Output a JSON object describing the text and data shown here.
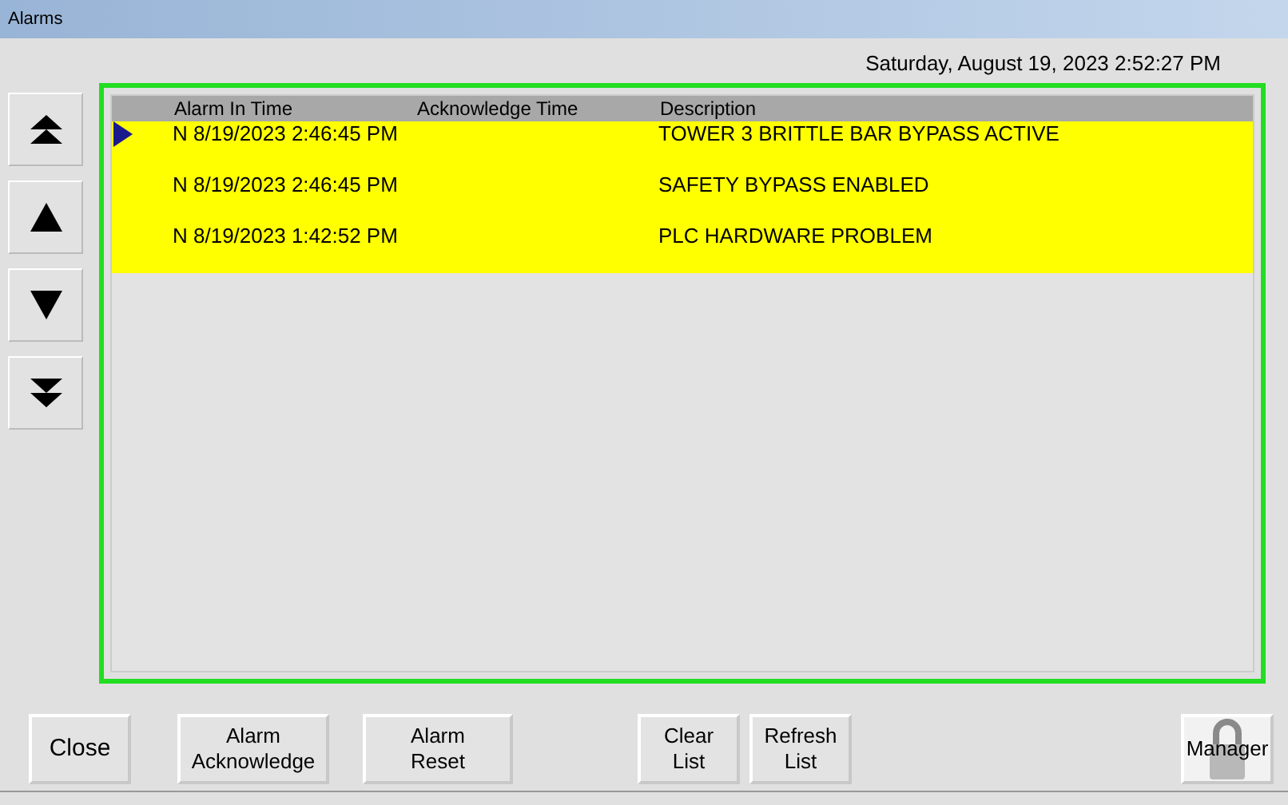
{
  "window": {
    "title": "Alarms"
  },
  "datetime": "Saturday, August 19, 2023 2:52:27 PM",
  "nav_buttons": [
    {
      "kind": "first"
    },
    {
      "kind": "up"
    },
    {
      "kind": "down"
    },
    {
      "kind": "last"
    }
  ],
  "table": {
    "columns": [
      "Alarm In Time",
      "Acknowledge Time",
      "Description"
    ],
    "rows": [
      {
        "selected": true,
        "cells": [
          "N 8/19/2023 2:46:45 PM",
          "",
          "TOWER 3 BRITTLE BAR BYPASS ACTIVE"
        ]
      },
      {
        "selected": false,
        "cells": [
          "N 8/19/2023 2:46:45 PM",
          "",
          "SAFETY BYPASS ENABLED"
        ]
      },
      {
        "selected": false,
        "cells": [
          "N 8/19/2023 1:42:52 PM",
          "",
          "PLC HARDWARE PROBLEM"
        ]
      }
    ]
  },
  "buttons": [
    {
      "label": "Close",
      "kind": "text"
    },
    {
      "label": "Alarm\nAcknowledge",
      "kind": "text"
    },
    {
      "label": "Alarm\nReset",
      "kind": "text"
    },
    {
      "label": "Clear\nList",
      "kind": "text"
    },
    {
      "label": "Refresh\nList",
      "kind": "text"
    },
    {
      "label": "Manager",
      "kind": "logo"
    }
  ]
}
